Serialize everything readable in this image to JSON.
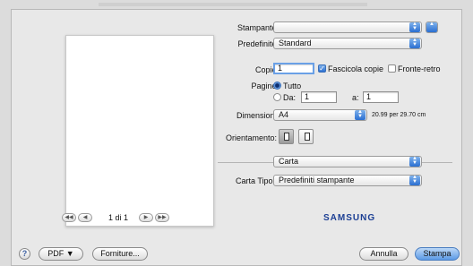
{
  "printer": {
    "label": "Stampante:",
    "value": ""
  },
  "presets": {
    "label": "Predefinite:",
    "value": "Standard"
  },
  "copies": {
    "label": "Copie:",
    "value": "1",
    "collate_label": "Fascicola copie",
    "duplex_label": "Fronte-retro"
  },
  "pages": {
    "label": "Pagine:",
    "all_label": "Tutto",
    "from_label": "Da:",
    "from_value": "1",
    "to_label": "a:",
    "to_value": "1"
  },
  "paper_size": {
    "label": "Dimensioni:",
    "value": "A4",
    "dims": "20.99 per 29.70 cm"
  },
  "orientation": {
    "label": "Orientamento:"
  },
  "section": {
    "value": "Carta"
  },
  "paper_type": {
    "label": "Carta Tipo:",
    "value": "Predefiniti stampante"
  },
  "preview_nav": {
    "first": "◀◀",
    "prev": "◀",
    "page_text": "1 di 1",
    "next": "▶",
    "last": "▶▶"
  },
  "brand": "SAMSUNG",
  "footer": {
    "help": "?",
    "pdf": "PDF ▼",
    "supplies": "Forniture...",
    "cancel": "Annulla",
    "print": "Stampa"
  }
}
